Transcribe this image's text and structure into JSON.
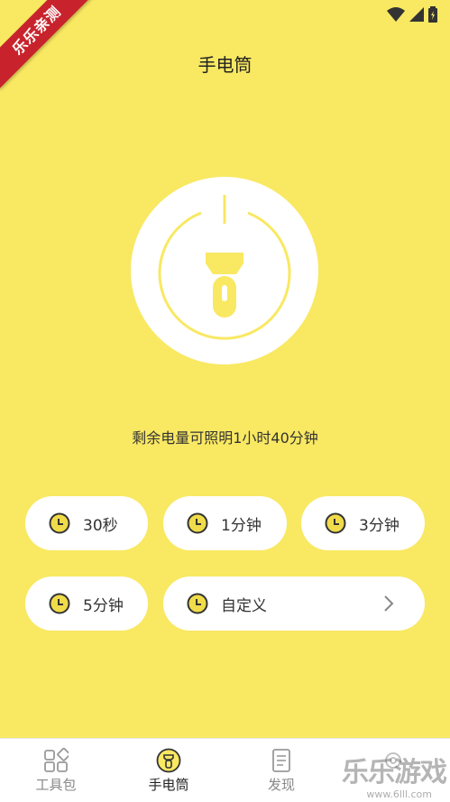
{
  "ribbon": {
    "text": "乐乐亲测"
  },
  "header": {
    "title": "手电筒"
  },
  "battery": {
    "text": "剩余电量可照明1小时40分钟"
  },
  "timers": [
    {
      "label": "30秒"
    },
    {
      "label": "1分钟"
    },
    {
      "label": "3分钟"
    },
    {
      "label": "5分钟"
    },
    {
      "label": "自定义"
    }
  ],
  "tabs": [
    {
      "label": "工具包",
      "icon": "grid-icon",
      "active": false
    },
    {
      "label": "手电筒",
      "icon": "flashlight-icon",
      "active": true
    },
    {
      "label": "发现",
      "icon": "document-icon",
      "active": false
    },
    {
      "label": "",
      "icon": "gear-icon",
      "active": false
    }
  ],
  "watermark": {
    "text": "乐乐游戏",
    "sub": "www.6lll.com"
  },
  "colors": {
    "background": "#F9E862",
    "accent": "#F9E862",
    "ribbon": "#C8232C",
    "clock": "#F0DC4A"
  }
}
